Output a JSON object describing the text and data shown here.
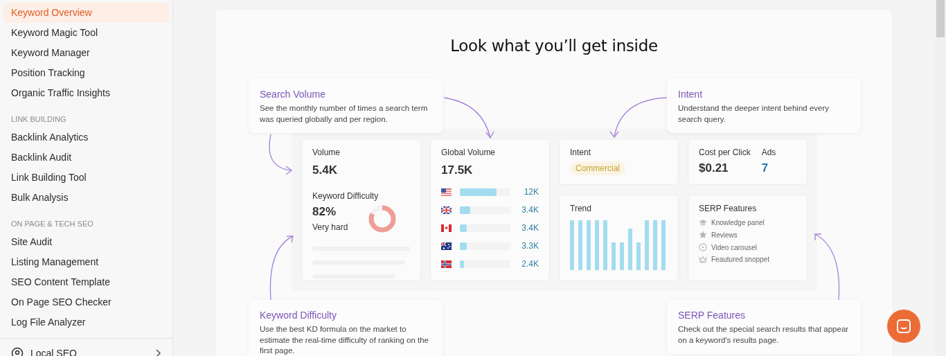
{
  "sidebar": {
    "groups": [
      {
        "items": [
          {
            "label": "Keyword Overview",
            "selected": true
          },
          {
            "label": "Keyword Magic Tool",
            "selected": false
          },
          {
            "label": "Keyword Manager",
            "selected": false
          },
          {
            "label": "Position Tracking",
            "selected": false
          },
          {
            "label": "Organic Traffic Insights",
            "selected": false
          }
        ]
      },
      {
        "heading": "LINK BUILDING",
        "items": [
          {
            "label": "Backlink Analytics",
            "selected": false
          },
          {
            "label": "Backlink Audit",
            "selected": false
          },
          {
            "label": "Link Building Tool",
            "selected": false
          },
          {
            "label": "Bulk Analysis",
            "selected": false
          }
        ]
      },
      {
        "heading": "ON PAGE & TECH SEO",
        "items": [
          {
            "label": "Site Audit",
            "selected": false
          },
          {
            "label": "Listing Management",
            "selected": false
          },
          {
            "label": "SEO Content Template",
            "selected": false
          },
          {
            "label": "On Page SEO Checker",
            "selected": false
          },
          {
            "label": "Log File Analyzer",
            "selected": false
          }
        ]
      }
    ],
    "footer_item": {
      "label": "Local SEO"
    }
  },
  "promo": {
    "title": "Look what you’ll get inside",
    "callouts": [
      {
        "title": "Search Volume",
        "text": "See the monthly number of times a search term was queried globally and per region."
      },
      {
        "title": "Intent",
        "text": "Understand the deeper intent behind every search query."
      },
      {
        "title": "Keyword Difficulty",
        "text": "Use the best KD formula on the market to estimate the real-time difficulty of ranking on the first page."
      },
      {
        "title": "SERP Features",
        "text": "Check out the special search results that appear on a keyword's results page."
      }
    ],
    "volume": {
      "label": "Volume",
      "value": "5.4K",
      "kd_label": "Keyword Difficulty",
      "kd_value": "82%",
      "kd_text": "Very hard"
    },
    "global_volume": {
      "label": "Global Volume",
      "value": "17.5K",
      "countries": [
        {
          "kind": "us",
          "value": "12K",
          "level": 0.72
        },
        {
          "kind": "uk",
          "value": "3.4K",
          "level": 0.2
        },
        {
          "kind": "ca",
          "value": "3.4K",
          "level": 0.14
        },
        {
          "kind": "au",
          "value": "3.3K",
          "level": 0.14
        },
        {
          "kind": "no",
          "value": "2.4K",
          "level": 0.08
        }
      ]
    },
    "intent": {
      "label": "Intent",
      "badge": "Commercial"
    },
    "cpc": {
      "label": "Cost per Click",
      "value": "$0.21",
      "ads_label": "Ads",
      "ads_value": "7"
    },
    "trend": {
      "label": "Trend"
    },
    "serp": {
      "label": "SERP Features",
      "features": [
        {
          "kind": "cap",
          "text": "Knowledge panel"
        },
        {
          "kind": "star",
          "text": "Reviews"
        },
        {
          "kind": "play",
          "text": "Video carousel"
        },
        {
          "kind": "crown",
          "text": "Feautured snoppet"
        }
      ]
    }
  }
}
